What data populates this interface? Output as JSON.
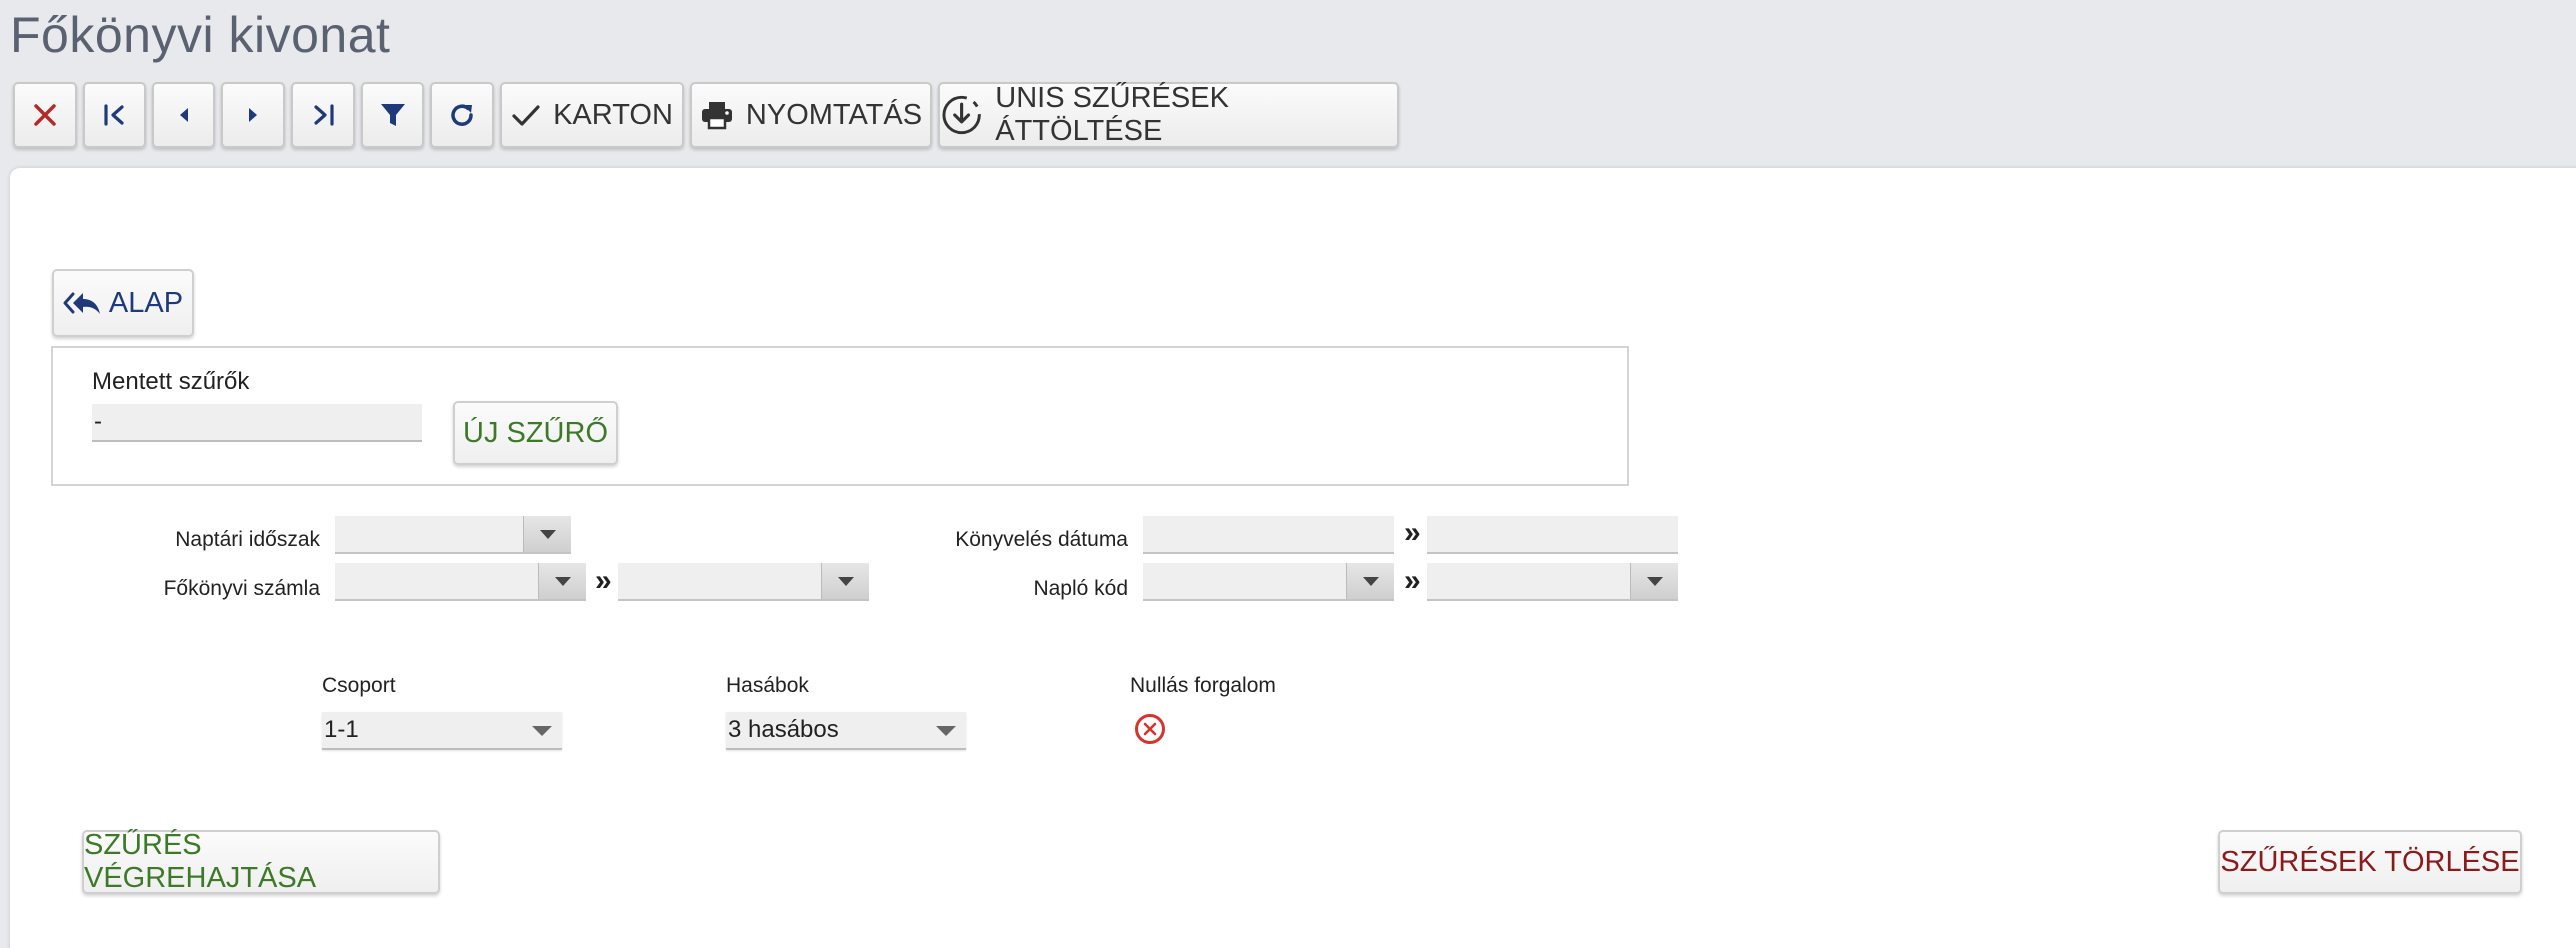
{
  "page": {
    "title": "Főkönyvi kivonat"
  },
  "toolbar": {
    "close_icon": "close-icon",
    "first_icon": "first-page-icon",
    "prev_icon": "prev-icon",
    "next_icon": "next-icon",
    "last_icon": "last-page-icon",
    "filter_icon": "filter-icon",
    "refresh_icon": "refresh-icon",
    "karton_label": "KARTON",
    "print_label": "NYOMTATÁS",
    "unis_label": "UNIS SZŰRÉSEK ÁTTÖLTÉSE",
    "colors": {
      "accent": "#1f3a7a",
      "close": "#b22b2b"
    }
  },
  "alap": {
    "label": "ALAP"
  },
  "saved_filters": {
    "label": "Mentett szűrők",
    "selected": "-",
    "new_button": "ÚJ SZŰRŐ"
  },
  "filters": {
    "naptari_idoszak_label": "Naptári időszak",
    "fokonyvi_szamla_label": "Főkönyvi számla",
    "konyveles_datuma_label": "Könyvelés dátuma",
    "naplo_kod_label": "Napló kód",
    "range_sep": "»"
  },
  "options": {
    "csoport_label": "Csoport",
    "csoport_value": "1-1",
    "hasabok_label": "Hasábok",
    "hasabok_value": "3 hasábos",
    "nullas_label": "Nullás forgalom",
    "nullas_enabled": false
  },
  "actions": {
    "run_label": "SZŰRÉS VÉGREHAJTÁSA",
    "clear_label": "SZŰRÉSEK TÖRLÉSE",
    "run_color": "#3d7a28",
    "clear_color": "#8b1a1a"
  }
}
